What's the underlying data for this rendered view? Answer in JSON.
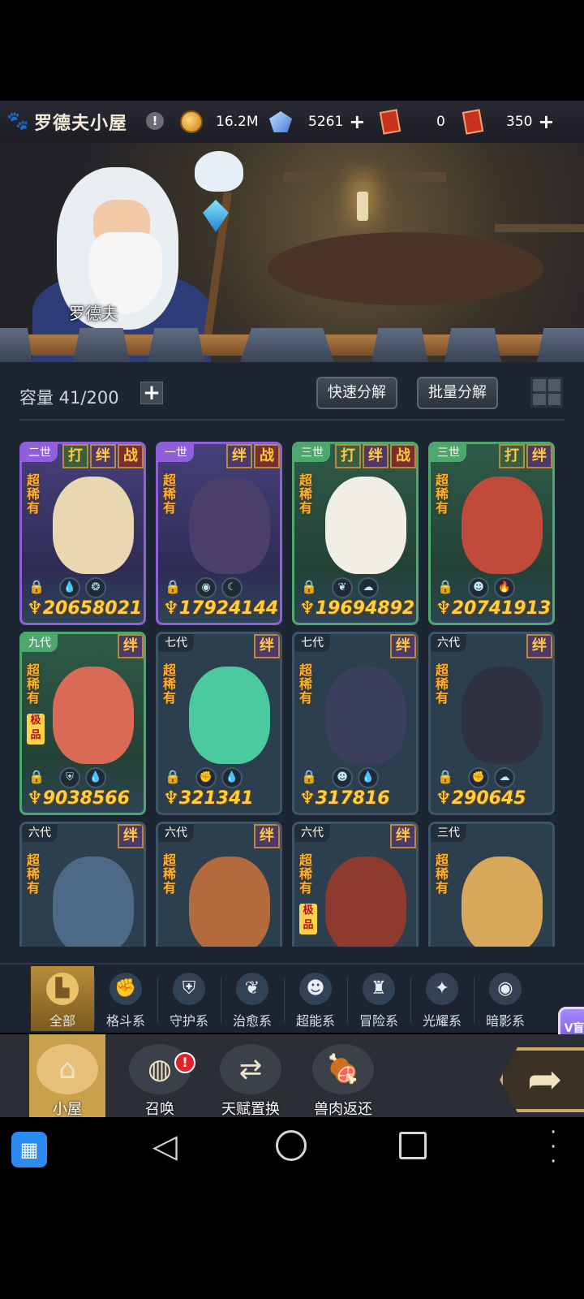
{
  "header": {
    "title": "罗德夫小屋",
    "info_icon": "info-icon",
    "coins": "16.2M",
    "gems": "5261",
    "ticket_a": "0",
    "ticket_b": "350"
  },
  "scene": {
    "npc_name": "罗德夫"
  },
  "panel": {
    "capacity": "容量 41/200",
    "quick_decompose": "快速分解",
    "batch_decompose": "批量分解"
  },
  "cards": [
    {
      "era": "二世",
      "tags": [
        "打",
        "绊",
        "战"
      ],
      "rarity": "超稀有",
      "extreme": "",
      "elements": [
        "water-drop-icon",
        "spirit-icon"
      ],
      "power": "20658021",
      "theme": "purple",
      "color": "#e8d7b0"
    },
    {
      "era": "一世",
      "tags": [
        "绊",
        "战"
      ],
      "rarity": "超稀有",
      "extreme": "",
      "elements": [
        "eye-icon",
        "moon-icon"
      ],
      "power": "17924144",
      "theme": "purple",
      "color": "#4a3f6b"
    },
    {
      "era": "三世",
      "tags": [
        "打",
        "绊",
        "战"
      ],
      "rarity": "超稀有",
      "extreme": "",
      "elements": [
        "sprout-icon",
        "cloud-icon"
      ],
      "power": "19694892",
      "theme": "green",
      "color": "#f1eee5"
    },
    {
      "era": "三世",
      "tags": [
        "打",
        "绊"
      ],
      "rarity": "超稀有",
      "extreme": "",
      "elements": [
        "alien-icon",
        "fire-icon"
      ],
      "power": "20741913",
      "theme": "green",
      "color": "#c24a3a"
    },
    {
      "era": "九代",
      "tags": [
        "绊"
      ],
      "rarity": "超稀有",
      "extreme": "极品",
      "elements": [
        "shield-icon",
        "water-drop-icon"
      ],
      "power": "9038566",
      "theme": "green",
      "color": "#d96a55"
    },
    {
      "era": "七代",
      "tags": [
        "绊"
      ],
      "rarity": "超稀有",
      "extreme": "",
      "elements": [
        "fist-icon",
        "water-drop-icon"
      ],
      "power": "321341",
      "theme": "plain",
      "color": "#4bcaa0"
    },
    {
      "era": "七代",
      "tags": [
        "绊"
      ],
      "rarity": "超稀有",
      "extreme": "",
      "elements": [
        "alien-icon",
        "water-drop-icon"
      ],
      "power": "317816",
      "theme": "plain",
      "color": "#3b3f5c"
    },
    {
      "era": "六代",
      "tags": [
        "绊"
      ],
      "rarity": "超稀有",
      "extreme": "",
      "elements": [
        "fist-icon",
        "cloud-icon"
      ],
      "power": "290645",
      "theme": "plain",
      "color": "#2f3140"
    },
    {
      "era": "六代",
      "tags": [
        "绊"
      ],
      "rarity": "超稀有",
      "extreme": "",
      "elements": [],
      "power": "",
      "theme": "plain",
      "color": "#4d6b86"
    },
    {
      "era": "六代",
      "tags": [
        "绊"
      ],
      "rarity": "超稀有",
      "extreme": "",
      "elements": [],
      "power": "",
      "theme": "plain",
      "color": "#b36a3d"
    },
    {
      "era": "六代",
      "tags": [
        "绊"
      ],
      "rarity": "超稀有",
      "extreme": "极品",
      "elements": [],
      "power": "",
      "theme": "plain",
      "color": "#8f3a2e"
    },
    {
      "era": "三代",
      "tags": [],
      "rarity": "超稀有",
      "extreme": "",
      "elements": [],
      "power": "",
      "theme": "plain",
      "color": "#d8a85a"
    }
  ],
  "categories": [
    {
      "label": "全部",
      "icon": "all-blocks-icon",
      "active": true
    },
    {
      "label": "格斗系",
      "icon": "fist-icon",
      "active": false
    },
    {
      "label": "守护系",
      "icon": "shield-icon",
      "active": false
    },
    {
      "label": "治愈系",
      "icon": "sprout-icon",
      "active": false
    },
    {
      "label": "超能系",
      "icon": "alien-icon",
      "active": false
    },
    {
      "label": "冒险系",
      "icon": "tower-icon",
      "active": false
    },
    {
      "label": "光耀系",
      "icon": "light-star-icon",
      "active": false
    },
    {
      "label": "暗影系",
      "icon": "shadow-eye-icon",
      "active": false
    }
  ],
  "nav": [
    {
      "label": "小屋",
      "icon": "cabin-icon",
      "active": true
    },
    {
      "label": "召唤",
      "icon": "egg-icon",
      "active": false
    },
    {
      "label": "天赋置换",
      "icon": "swap-arrows-icon",
      "active": false
    },
    {
      "label": "兽肉返还",
      "icon": "meat-icon",
      "active": false
    }
  ],
  "badges": {
    "summon": "!"
  },
  "vip_label": "V盲"
}
